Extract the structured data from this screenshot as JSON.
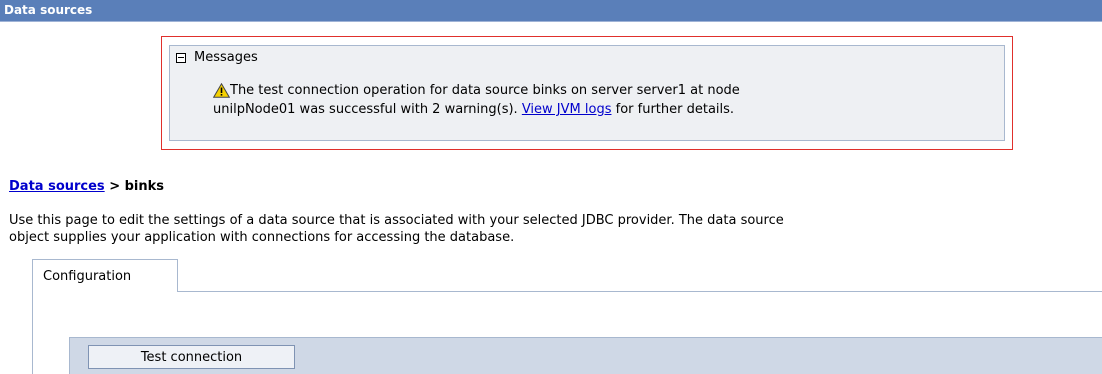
{
  "header": {
    "title": "Data sources"
  },
  "messages": {
    "heading": "Messages",
    "line1": "The test connection operation for data source binks on server server1 at node",
    "line2_prefix": "unilpNode01 was successful with 2 warning(s). ",
    "link_text": "View JVM logs",
    "line2_suffix": " for further details."
  },
  "breadcrumb": {
    "link": "Data sources",
    "separator": " > ",
    "current": "binks"
  },
  "description": {
    "line1": "Use this page to edit the settings of a data source that is associated with your selected JDBC provider. The data source",
    "line2": "object supplies your application with connections for accessing the database."
  },
  "tabs": [
    {
      "label": "Configuration"
    }
  ],
  "buttons": {
    "test_connection": "Test connection"
  },
  "colors": {
    "title_bar": "#5a7fb9",
    "message_border": "#e0302c",
    "message_bg": "#eef0f3",
    "link": "#0000cc",
    "panel_bg": "#cfd8e6"
  },
  "icons": {
    "message": "warning-icon",
    "collapse": "collapse-minus-icon"
  }
}
